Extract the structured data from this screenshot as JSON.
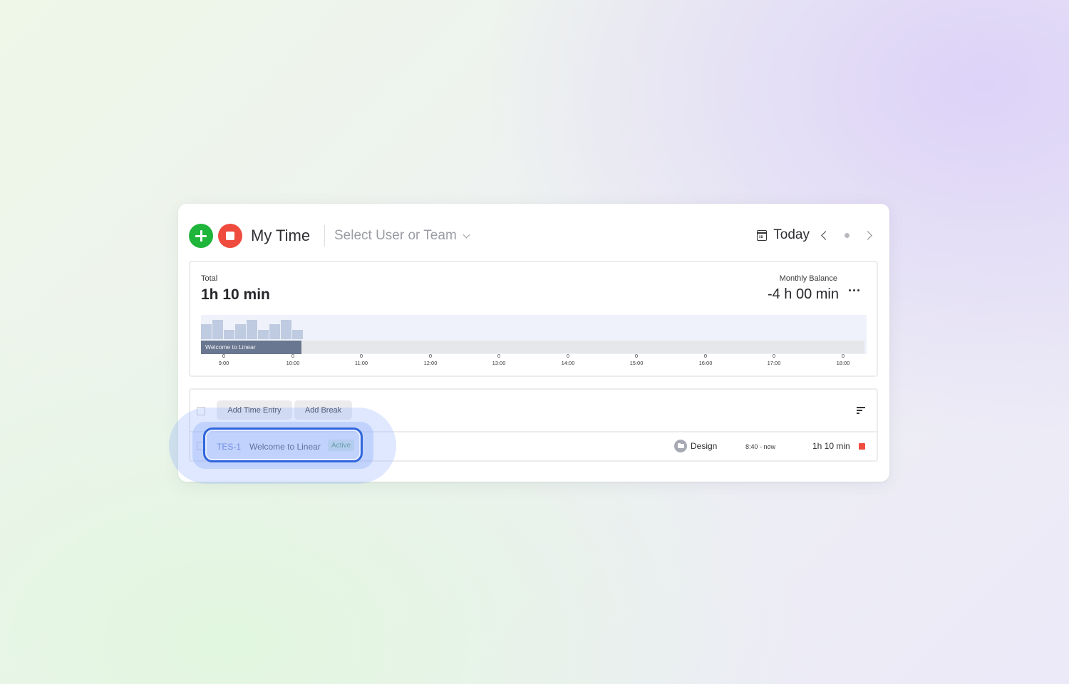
{
  "header": {
    "add_icon": "plus-icon",
    "stop_icon": "stop-icon",
    "title": "My Time",
    "user_select_placeholder": "Select User or Team",
    "date_label": "Today",
    "calendar_icon": "calendar-icon"
  },
  "summary": {
    "total_label": "Total",
    "total_value": "1h 10 min",
    "balance_label": "Monthly Balance",
    "balance_value": "-4 h 00 min",
    "timeline": {
      "entry_label": "Welcome to Linear",
      "ticks": [
        {
          "count": "0",
          "time": "9:00"
        },
        {
          "count": "0",
          "time": "10:00"
        },
        {
          "count": "0",
          "time": "11:00"
        },
        {
          "count": "0",
          "time": "12:00"
        },
        {
          "count": "0",
          "time": "13:00"
        },
        {
          "count": "0",
          "time": "14:00"
        },
        {
          "count": "0",
          "time": "15:00"
        },
        {
          "count": "0",
          "time": "16:00"
        },
        {
          "count": "0",
          "time": "17:00"
        },
        {
          "count": "0",
          "time": "18:00"
        }
      ]
    }
  },
  "entries": {
    "add_time_entry": "Add Time Entry",
    "add_break": "Add Break",
    "rows": [
      {
        "issue_id": "TES-1",
        "title": "Welcome to Linear",
        "status": "Active",
        "project": "Design",
        "time_range": "8:40 - now",
        "duration": "1h 10 min"
      }
    ]
  },
  "colors": {
    "add": "#1eb53a",
    "stop": "#ef4b3f",
    "link": "#4f6ac8",
    "focus": "#2f66dd"
  }
}
